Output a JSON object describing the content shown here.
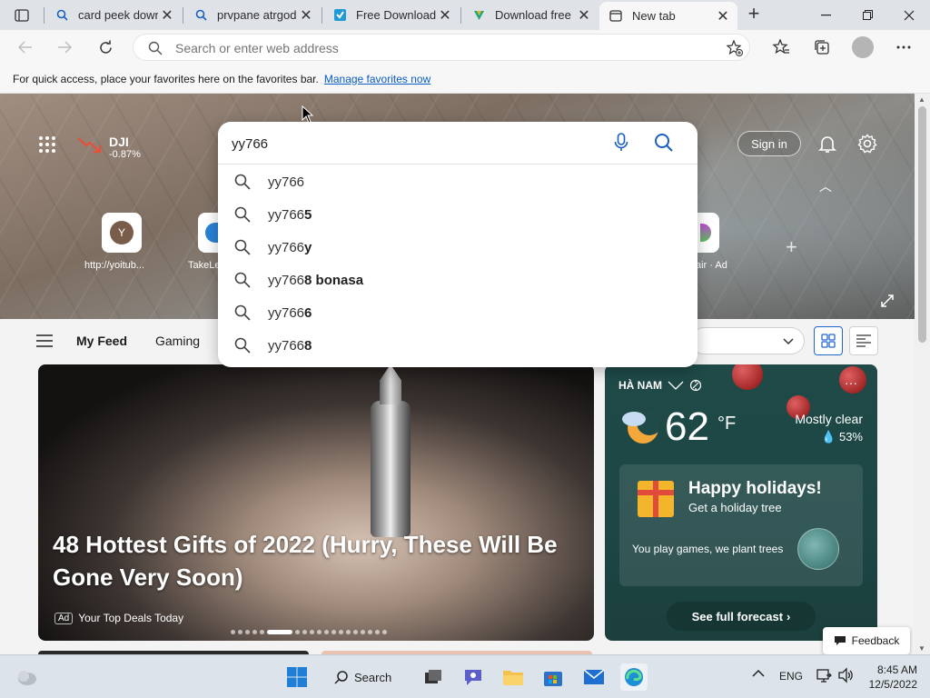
{
  "browser": {
    "tabs": [
      {
        "title": "card peek downl",
        "icon": "search-icon",
        "active": false
      },
      {
        "title": "prvpane atrgod.",
        "icon": "search-icon",
        "active": false
      },
      {
        "title": "Free Download",
        "icon": "site-icon",
        "active": false
      },
      {
        "title": "Download free N",
        "icon": "download-site-icon",
        "active": false
      },
      {
        "title": "New tab",
        "icon": "newtab-icon",
        "active": true
      }
    ],
    "address_placeholder": "Search or enter web address",
    "favorites_message": "For quick access, place your favorites here on the favorites bar.",
    "favorites_link": "Manage favorites now"
  },
  "hero": {
    "stock_symbol": "DJI",
    "stock_change": "-0.87%",
    "signin_label": "Sign in",
    "quick_links": [
      {
        "label": "http://yoitub...",
        "initial": "Y"
      },
      {
        "label": "TakeLe",
        "initial": ""
      },
      {
        "label": "air · Ad",
        "initial": ""
      }
    ]
  },
  "search": {
    "query": "yy766",
    "suggestions": [
      {
        "base": "yy766",
        "bold": ""
      },
      {
        "base": "yy766",
        "bold": "5"
      },
      {
        "base": "yy766",
        "bold": "y"
      },
      {
        "base": "yy766",
        "bold": "8 bonasa"
      },
      {
        "base": "yy766",
        "bold": "6"
      },
      {
        "base": "yy766",
        "bold": "8"
      }
    ]
  },
  "feed": {
    "tabs": [
      "My Feed",
      "Gaming"
    ]
  },
  "main_card": {
    "headline": "48 Hottest Gifts of 2022 (Hurry, These Will Be Gone Very Soon)",
    "ad_label": "Ad",
    "source": "Your Top Deals Today"
  },
  "weather": {
    "location": "HÀ NAM",
    "temperature": "62",
    "unit": "°F",
    "condition": "Mostly clear",
    "humidity": "53%",
    "holiday_title": "Happy holidays!",
    "holiday_sub": "Get a holiday tree",
    "holiday_text": "You play games, we plant trees",
    "forecast_button": "See full forecast"
  },
  "feedback_label": "Feedback",
  "taskbar": {
    "search_label": "Search",
    "language": "ENG",
    "time": "8:45 AM",
    "date": "12/5/2022"
  },
  "colors": {
    "accent": "#2266d3",
    "weather_bg": "#1f4a48",
    "titlebar": "#dfe3e8",
    "taskbar": "#dde3ea"
  }
}
